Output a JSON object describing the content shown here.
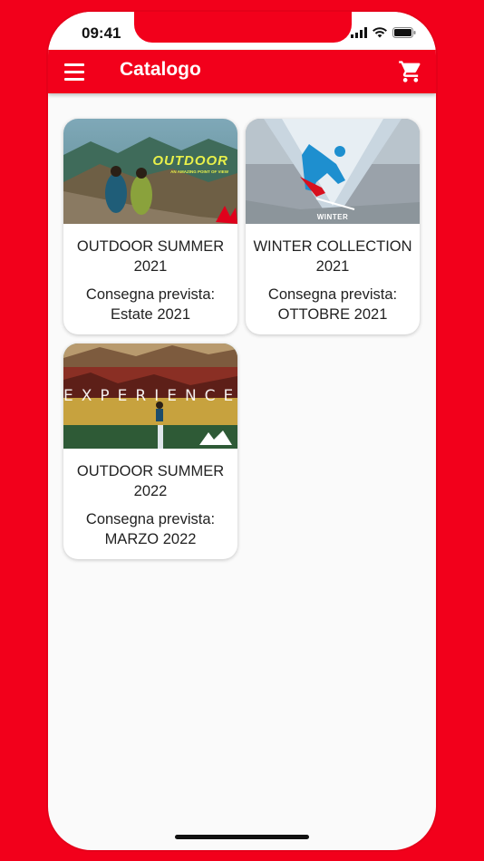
{
  "status_bar": {
    "time": "09:41"
  },
  "app_bar": {
    "title": "Catalogo",
    "menu_icon": "menu-icon",
    "cart_icon": "shopping-cart-icon"
  },
  "catalog": {
    "items": [
      {
        "title_line1": "OUTDOOR SUMMER",
        "title_line2": "2021",
        "delivery_line1": "Consegna prevista:",
        "delivery_line2": "Estate 2021",
        "banner_text": "OUTDOOR",
        "banner_subtext": "AN AMAZING POINT OF VIEW"
      },
      {
        "title_line1": "WINTER COLLECTION",
        "title_line2": "2021",
        "delivery_line1": "Consegna prevista:",
        "delivery_line2": "OTTOBRE 2021",
        "banner_text": "WINTER"
      },
      {
        "title_line1": "OUTDOOR SUMMER",
        "title_line2": "2022",
        "delivery_line1": "Consegna prevista:",
        "delivery_line2": "MARZO 2022",
        "banner_text": "EXPERIENCE"
      }
    ]
  },
  "colors": {
    "brand_red": "#f2001b",
    "background": "#fafafa",
    "card": "#ffffff"
  }
}
